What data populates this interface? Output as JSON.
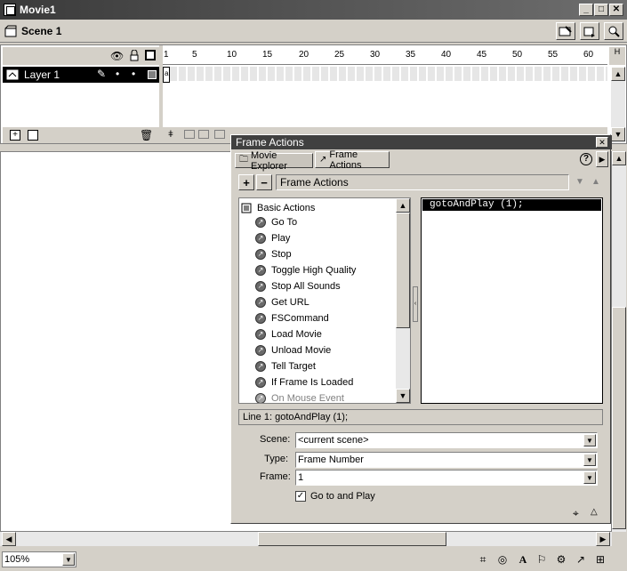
{
  "window": {
    "title": "Movie1",
    "minimize": "_",
    "maximize": "□",
    "close": "✕"
  },
  "scenebar": {
    "scene_label": "Scene 1"
  },
  "timeline": {
    "header_icons": [
      "eye-icon",
      "lock-icon",
      "outline-icon"
    ],
    "frame_numbers": [
      "1",
      "5",
      "10",
      "15",
      "20",
      "25",
      "30",
      "35",
      "40",
      "45",
      "50",
      "55",
      "60"
    ],
    "layer": {
      "name": "Layer 1"
    }
  },
  "panel": {
    "title": "Frame Actions",
    "close": "✕",
    "tabs": [
      "Movie Explorer",
      "Frame Actions"
    ],
    "help": "?",
    "toolbar": {
      "add": "+",
      "remove": "−",
      "mode_label": "Frame Actions"
    },
    "actions": {
      "category": "Basic Actions",
      "items": [
        "Go To",
        "Play",
        "Stop",
        "Toggle High Quality",
        "Stop All Sounds",
        "Get URL",
        "FSCommand",
        "Load Movie",
        "Unload Movie",
        "Tell Target",
        "If Frame Is Loaded",
        "On Mouse Event"
      ]
    },
    "script": {
      "line": "gotoAndPlay (1);"
    },
    "status_line": "Line 1: gotoAndPlay (1);",
    "params": {
      "scene_label": "Scene:",
      "scene_value": "<current scene>",
      "type_label": "Type:",
      "type_value": "Frame Number",
      "frame_label": "Frame:",
      "frame_value": "1",
      "checkbox_label": "Go to and Play",
      "checkbox_checked": true
    }
  },
  "bottombar": {
    "zoom": "105%"
  }
}
